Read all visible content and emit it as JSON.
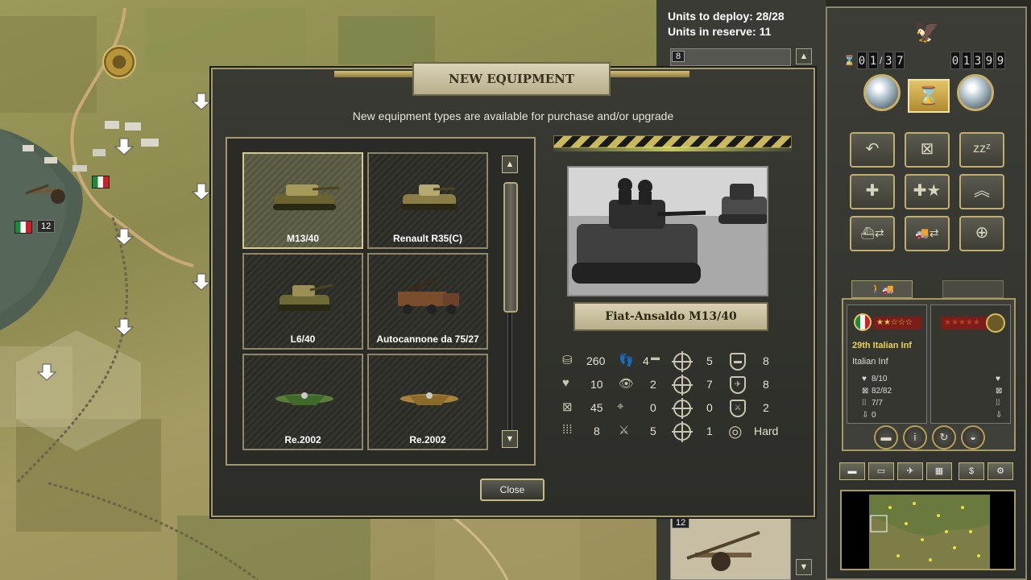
{
  "deploy": {
    "units_to_deploy": "Units to deploy: 28/28",
    "units_in_reserve": "Units in reserve: 11",
    "slot_top_num": "8",
    "slot_bottom_num": "12"
  },
  "map": {
    "unit_strength": "12"
  },
  "sidebar": {
    "turn_digits": [
      "0",
      "1",
      "3",
      "7"
    ],
    "turn_separator": "/",
    "prestige_digits": [
      "0",
      "1",
      "3",
      "9",
      "9"
    ],
    "action_buttons": [
      "undo-icon",
      "delete-icon",
      "sleep-icon",
      "reinforce-icon",
      "elite-reinforce-icon",
      "upgrade-icon",
      "embark-naval-icon",
      "mount-transport-icon",
      "air-mission-icon"
    ],
    "unit": {
      "name": "29th Italian Inf",
      "type": "Italian Inf",
      "stats": [
        "8/10",
        "82/82",
        "7/7",
        "0"
      ]
    },
    "tools": [
      "tank-icon",
      "tank2-icon",
      "airplane-icon",
      "grid-icon",
      "$",
      "settings-icon"
    ]
  },
  "dialog": {
    "title": "NEW EQUIPMENT",
    "subtitle": "New equipment types are available for purchase and/or upgrade",
    "items": [
      {
        "label": "M13/40",
        "selected": true
      },
      {
        "label": "Renault R35(C)",
        "selected": false
      },
      {
        "label": "L6/40",
        "selected": false
      },
      {
        "label": "Autocannone da 75/27",
        "selected": false
      },
      {
        "label": "Re.2002",
        "selected": false
      },
      {
        "label": "Re.2002",
        "selected": false
      }
    ],
    "selected_name": "Fiat-Ansaldo M13/40",
    "stats": {
      "cost": "260",
      "strength": "10",
      "ammo": "45",
      "ammo_count": "8",
      "movement": "4",
      "spotting": "2",
      "range": "0",
      "fuel": "5",
      "soft_attack": "5",
      "hard_attack": "7",
      "air_attack": "0",
      "naval_attack": "1",
      "ground_defense": "8",
      "air_defense": "8",
      "close_defense": "2",
      "target_type": "Hard"
    },
    "close_label": "Close"
  }
}
